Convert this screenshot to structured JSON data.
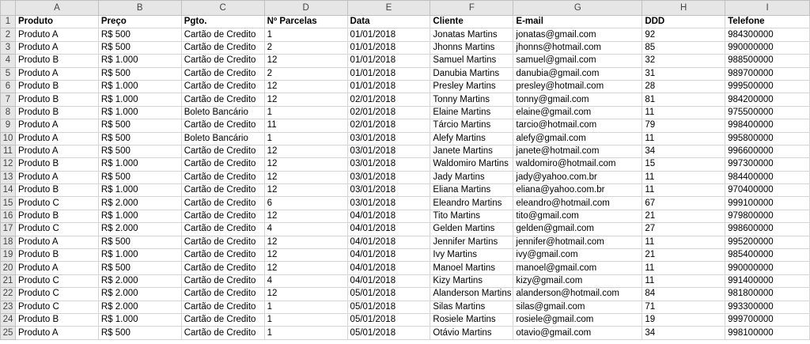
{
  "columns": [
    "A",
    "B",
    "C",
    "D",
    "E",
    "F",
    "G",
    "H",
    "I"
  ],
  "header": [
    "Produto",
    "Preço",
    "Pgto.",
    "Nº Parcelas",
    "Data",
    "Cliente",
    "E-mail",
    "DDD",
    "Telefone"
  ],
  "rows": [
    [
      "Produto A",
      "R$ 500",
      "Cartão de Credito",
      "1",
      "01/01/2018",
      "Jonatas Martins",
      "jonatas@gmail.com",
      "92",
      "984300000"
    ],
    [
      "Produto A",
      "R$ 500",
      "Cartão de Credito",
      "2",
      "01/01/2018",
      "Jhonns Martins",
      "jhonns@hotmail.com",
      "85",
      "990000000"
    ],
    [
      "Produto B",
      "R$ 1.000",
      "Cartão de Credito",
      "12",
      "01/01/2018",
      "Samuel Martins",
      "samuel@gmail.com",
      "32",
      "988500000"
    ],
    [
      "Produto A",
      "R$ 500",
      "Cartão de Credito",
      "2",
      "01/01/2018",
      "Danubia Martins",
      "danubia@gmail.com",
      "31",
      "989700000"
    ],
    [
      "Produto B",
      "R$ 1.000",
      "Cartão de Credito",
      "12",
      "01/01/2018",
      "Presley Martins",
      "presley@hotmail.com",
      "28",
      "999500000"
    ],
    [
      "Produto B",
      "R$ 1.000",
      "Cartão de Credito",
      "12",
      "02/01/2018",
      "Tonny Martins",
      "tonny@gmail.com",
      "81",
      "984200000"
    ],
    [
      "Produto B",
      "R$ 1.000",
      "Boleto Bancário",
      "1",
      "02/01/2018",
      "Elaine Martins",
      "elaine@gmail.com",
      "11",
      "975500000"
    ],
    [
      "Produto A",
      "R$ 500",
      "Cartão de Credito",
      "11",
      "02/01/2018",
      "Tárcio Martins",
      "tarcio@hotmail.com",
      "79",
      "998400000"
    ],
    [
      "Produto A",
      "R$ 500",
      "Boleto Bancário",
      "1",
      "03/01/2018",
      "Alefy Martins",
      "alefy@gmail.com",
      "11",
      "995800000"
    ],
    [
      "Produto A",
      "R$ 500",
      "Cartão de Credito",
      "12",
      "03/01/2018",
      "Janete Martins",
      "janete@hotmail.com",
      "34",
      "996600000"
    ],
    [
      "Produto B",
      "R$ 1.000",
      "Cartão de Credito",
      "12",
      "03/01/2018",
      "Waldomiro Martins",
      "waldomiro@hotmail.com",
      "15",
      "997300000"
    ],
    [
      "Produto A",
      "R$ 500",
      "Cartão de Credito",
      "12",
      "03/01/2018",
      "Jady Martins",
      "jady@yahoo.com.br",
      "11",
      "984400000"
    ],
    [
      "Produto B",
      "R$ 1.000",
      "Cartão de Credito",
      "12",
      "03/01/2018",
      "Eliana Martins",
      "eliana@yahoo.com.br",
      "11",
      "970400000"
    ],
    [
      "Produto C",
      "R$ 2.000",
      "Cartão de Credito",
      "6",
      "03/01/2018",
      "Eleandro Martins",
      "eleandro@hotmail.com",
      "67",
      "999100000"
    ],
    [
      "Produto B",
      "R$ 1.000",
      "Cartão de Credito",
      "12",
      "04/01/2018",
      "Tito Martins",
      "tito@gmail.com",
      "21",
      "979800000"
    ],
    [
      "Produto C",
      "R$ 2.000",
      "Cartão de Credito",
      "4",
      "04/01/2018",
      "Gelden Martins",
      "gelden@gmail.com",
      "27",
      "998600000"
    ],
    [
      "Produto A",
      "R$ 500",
      "Cartão de Credito",
      "12",
      "04/01/2018",
      "Jennifer Martins",
      "jennifer@hotmail.com",
      "11",
      "995200000"
    ],
    [
      "Produto B",
      "R$ 1.000",
      "Cartão de Credito",
      "12",
      "04/01/2018",
      "Ivy Martins",
      "ivy@gmail.com",
      "21",
      "985400000"
    ],
    [
      "Produto A",
      "R$ 500",
      "Cartão de Credito",
      "12",
      "04/01/2018",
      "Manoel Martins",
      "manoel@gmail.com",
      "11",
      "990000000"
    ],
    [
      "Produto C",
      "R$ 2.000",
      "Cartão de Credito",
      "4",
      "04/01/2018",
      "Kizy Martins",
      "kizy@gmail.com",
      "11",
      "991400000"
    ],
    [
      "Produto C",
      "R$ 2.000",
      "Cartão de Credito",
      "12",
      "05/01/2018",
      "Alanderson Martins",
      "alanderson@hotmail.com",
      "84",
      "981800000"
    ],
    [
      "Produto C",
      "R$ 2.000",
      "Cartão de Credito",
      "1",
      "05/01/2018",
      "Silas Martins",
      "silas@gmail.com",
      "71",
      "993300000"
    ],
    [
      "Produto B",
      "R$ 1.000",
      "Cartão de Credito",
      "1",
      "05/01/2018",
      "Rosiele Martins",
      "rosiele@gmail.com",
      "19",
      "999700000"
    ],
    [
      "Produto A",
      "R$ 500",
      "Cartão de Credito",
      "1",
      "05/01/2018",
      "Otávio Martins",
      "otavio@gmail.com",
      "34",
      "998100000"
    ]
  ]
}
